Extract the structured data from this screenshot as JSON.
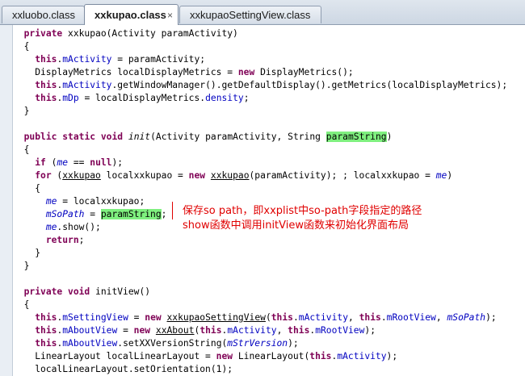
{
  "tabs": [
    {
      "label": "xxluobo.class",
      "active": false
    },
    {
      "label": "xxkupao.class",
      "active": true,
      "close": "×"
    },
    {
      "label": "xxkupaoSettingView.class",
      "active": false
    }
  ],
  "code_lines": [
    [
      {
        "t": "  "
      },
      {
        "t": "private",
        "c": "kw"
      },
      {
        "t": " xxkupao(Activity paramActivity)"
      }
    ],
    [
      {
        "t": "  {"
      }
    ],
    [
      {
        "t": "    "
      },
      {
        "t": "this",
        "c": "kw"
      },
      {
        "t": "."
      },
      {
        "t": "mActivity",
        "c": "fld"
      },
      {
        "t": " = paramActivity;"
      }
    ],
    [
      {
        "t": "    DisplayMetrics localDisplayMetrics = "
      },
      {
        "t": "new",
        "c": "kw"
      },
      {
        "t": " DisplayMetrics();"
      }
    ],
    [
      {
        "t": "    "
      },
      {
        "t": "this",
        "c": "kw"
      },
      {
        "t": "."
      },
      {
        "t": "mActivity",
        "c": "fld"
      },
      {
        "t": ".getWindowManager().getDefaultDisplay().getMetrics(localDisplayMetrics);"
      }
    ],
    [
      {
        "t": "    "
      },
      {
        "t": "this",
        "c": "kw"
      },
      {
        "t": "."
      },
      {
        "t": "mDp",
        "c": "fld"
      },
      {
        "t": " = localDisplayMetrics."
      },
      {
        "t": "density",
        "c": "fld"
      },
      {
        "t": ";"
      }
    ],
    [
      {
        "t": "  }"
      }
    ],
    [],
    [
      {
        "t": "  "
      },
      {
        "t": "public",
        "c": "kw"
      },
      {
        "t": " "
      },
      {
        "t": "static",
        "c": "kw"
      },
      {
        "t": " "
      },
      {
        "t": "void",
        "c": "kw"
      },
      {
        "t": " "
      },
      {
        "t": "init",
        "c": "it"
      },
      {
        "t": "(Activity paramActivity, String "
      },
      {
        "t": "paramString",
        "c": "hl"
      },
      {
        "t": ")"
      }
    ],
    [
      {
        "t": "  {"
      }
    ],
    [
      {
        "t": "    "
      },
      {
        "t": "if",
        "c": "kw"
      },
      {
        "t": " ("
      },
      {
        "t": "me",
        "c": "fld it"
      },
      {
        "t": " == "
      },
      {
        "t": "null",
        "c": "kw"
      },
      {
        "t": ");"
      }
    ],
    [
      {
        "t": "    "
      },
      {
        "t": "for",
        "c": "kw"
      },
      {
        "t": " ("
      },
      {
        "t": "xxkupao",
        "c": "ul"
      },
      {
        "t": " localxxkupao = "
      },
      {
        "t": "new",
        "c": "kw"
      },
      {
        "t": " "
      },
      {
        "t": "xxkupao",
        "c": "ul"
      },
      {
        "t": "(paramActivity); ; localxxkupao = "
      },
      {
        "t": "me",
        "c": "fld it"
      },
      {
        "t": ")"
      }
    ],
    [
      {
        "t": "    {"
      }
    ],
    [
      {
        "t": "      "
      },
      {
        "t": "me",
        "c": "fld it"
      },
      {
        "t": " = localxxkupao;"
      }
    ],
    [
      {
        "t": "      "
      },
      {
        "t": "mSoPath",
        "c": "fld it"
      },
      {
        "t": " = "
      },
      {
        "t": "paramString",
        "c": "hl"
      },
      {
        "t": ";"
      }
    ],
    [
      {
        "t": "      "
      },
      {
        "t": "me",
        "c": "fld it"
      },
      {
        "t": ".show();"
      }
    ],
    [
      {
        "t": "      "
      },
      {
        "t": "return",
        "c": "kw"
      },
      {
        "t": ";"
      }
    ],
    [
      {
        "t": "    }"
      }
    ],
    [
      {
        "t": "  }"
      }
    ],
    [],
    [
      {
        "t": "  "
      },
      {
        "t": "private",
        "c": "kw"
      },
      {
        "t": " "
      },
      {
        "t": "void",
        "c": "kw"
      },
      {
        "t": " initView()"
      }
    ],
    [
      {
        "t": "  {"
      }
    ],
    [
      {
        "t": "    "
      },
      {
        "t": "this",
        "c": "kw"
      },
      {
        "t": "."
      },
      {
        "t": "mSettingView",
        "c": "fld"
      },
      {
        "t": " = "
      },
      {
        "t": "new",
        "c": "kw"
      },
      {
        "t": " "
      },
      {
        "t": "xxkupaoSettingView",
        "c": "ul"
      },
      {
        "t": "("
      },
      {
        "t": "this",
        "c": "kw"
      },
      {
        "t": "."
      },
      {
        "t": "mActivity",
        "c": "fld"
      },
      {
        "t": ", "
      },
      {
        "t": "this",
        "c": "kw"
      },
      {
        "t": "."
      },
      {
        "t": "mRootView",
        "c": "fld"
      },
      {
        "t": ", "
      },
      {
        "t": "mSoPath",
        "c": "fld it"
      },
      {
        "t": ");"
      }
    ],
    [
      {
        "t": "    "
      },
      {
        "t": "this",
        "c": "kw"
      },
      {
        "t": "."
      },
      {
        "t": "mAboutView",
        "c": "fld"
      },
      {
        "t": " = "
      },
      {
        "t": "new",
        "c": "kw"
      },
      {
        "t": " "
      },
      {
        "t": "xxAbout",
        "c": "ul"
      },
      {
        "t": "("
      },
      {
        "t": "this",
        "c": "kw"
      },
      {
        "t": "."
      },
      {
        "t": "mActivity",
        "c": "fld"
      },
      {
        "t": ", "
      },
      {
        "t": "this",
        "c": "kw"
      },
      {
        "t": "."
      },
      {
        "t": "mRootView",
        "c": "fld"
      },
      {
        "t": ");"
      }
    ],
    [
      {
        "t": "    "
      },
      {
        "t": "this",
        "c": "kw"
      },
      {
        "t": "."
      },
      {
        "t": "mAboutView",
        "c": "fld"
      },
      {
        "t": ".setXXVersionString("
      },
      {
        "t": "mStrVersion",
        "c": "fld it"
      },
      {
        "t": ");"
      }
    ],
    [
      {
        "t": "    LinearLayout localLinearLayout = "
      },
      {
        "t": "new",
        "c": "kw"
      },
      {
        "t": " LinearLayout("
      },
      {
        "t": "this",
        "c": "kw"
      },
      {
        "t": "."
      },
      {
        "t": "mActivity",
        "c": "fld"
      },
      {
        "t": ");"
      }
    ],
    [
      {
        "t": "    localLinearLayout.setOrientation(1);"
      }
    ]
  ],
  "annotation": {
    "line1": "保存so path，即xxplist中so-path字段指定的路径",
    "line2": "show函数中调用initView函数来初始化界面布局"
  },
  "colors": {
    "keyword": "#7f0055",
    "field": "#0000c0",
    "highlight": "#7ff07f",
    "annotation": "#e00000"
  }
}
